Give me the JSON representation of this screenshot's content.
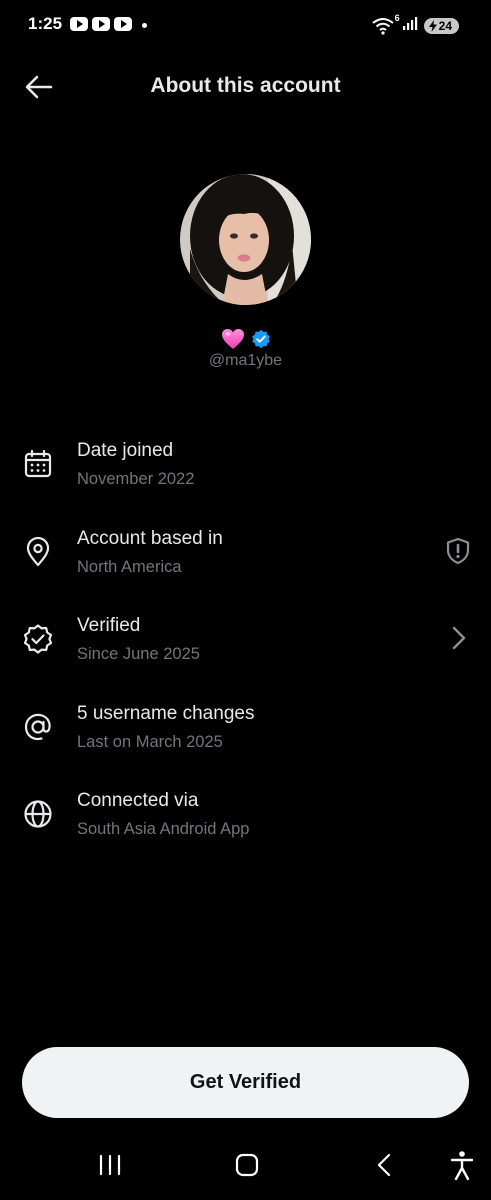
{
  "status_bar": {
    "time": "1:25",
    "battery_level": "24",
    "network_badge": "6"
  },
  "header": {
    "title": "About this account"
  },
  "profile": {
    "handle": "@ma1ybe",
    "emoji": "pink-heart-icon",
    "verified": true
  },
  "info_rows": [
    {
      "icon": "calendar-icon",
      "title": "Date joined",
      "subtitle": "November 2022"
    },
    {
      "icon": "location-pin-icon",
      "title": "Account based in",
      "subtitle": "North America",
      "trailing": "shield-alert-icon"
    },
    {
      "icon": "verified-badge-icon",
      "title": "Verified",
      "subtitle": "Since June 2025",
      "trailing": "chevron-right-icon"
    },
    {
      "icon": "at-sign-icon",
      "title": "5 username changes",
      "subtitle": "Last on March 2025"
    },
    {
      "icon": "globe-icon",
      "title": "Connected via",
      "subtitle": "South Asia Android App"
    }
  ],
  "cta": {
    "label": "Get Verified"
  },
  "colors": {
    "background": "#000000",
    "primary_text": "#e7e9ea",
    "secondary_text": "#71767b",
    "verified_blue": "#1d9bf0",
    "button_bg": "#eff3f4"
  }
}
